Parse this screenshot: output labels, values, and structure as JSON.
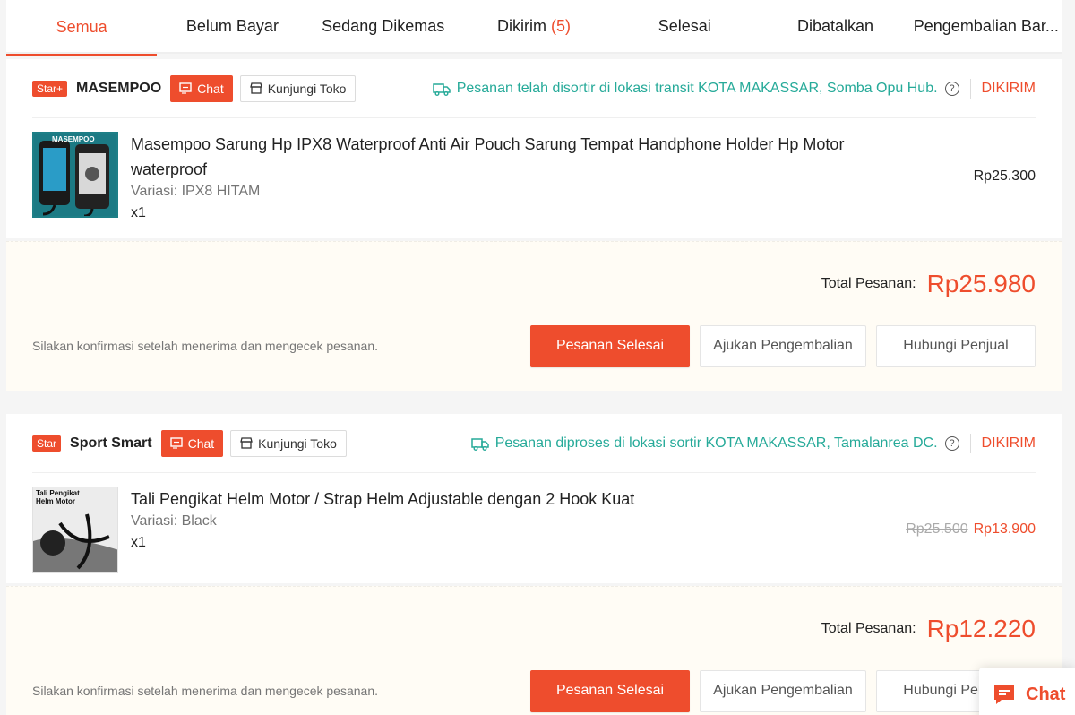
{
  "tabs": [
    {
      "label": "Semua",
      "active": true
    },
    {
      "label": "Belum Bayar"
    },
    {
      "label": "Sedang Dikemas"
    },
    {
      "label": "Dikirim",
      "count": "(5)"
    },
    {
      "label": "Selesai"
    },
    {
      "label": "Dibatalkan"
    },
    {
      "label": "Pengembalian Bar..."
    }
  ],
  "orders": [
    {
      "badge": "Star+",
      "shop_name": "MASEMPOO",
      "chat_label": "Chat",
      "visit_label": "Kunjungi Toko",
      "shipping_text": "Pesanan telah disortir di lokasi transit KOTA MAKASSAR, Somba Opu Hub.",
      "help_icon": "?",
      "status": "DIKIRIM",
      "product": {
        "name": "Masempoo Sarung Hp IPX8 Waterproof Anti Air Pouch Sarung Tempat Handphone Holder Hp Motor waterproof",
        "variation": "Variasi: IPX8 HITAM",
        "qty": "x1",
        "price": "Rp25.300",
        "thumb_label": "MASEMPOO"
      },
      "total_label": "Total Pesanan:",
      "total_value": "Rp25.980",
      "hint": "Silakan konfirmasi setelah menerima dan mengecek pesanan.",
      "btn_complete": "Pesanan Selesai",
      "btn_return": "Ajukan Pengembalian",
      "btn_contact": "Hubungi Penjual"
    },
    {
      "badge": "Star",
      "shop_name": "Sport Smart",
      "chat_label": "Chat",
      "visit_label": "Kunjungi Toko",
      "shipping_text": "Pesanan diproses di lokasi sortir KOTA MAKASSAR, Tamalanrea DC.",
      "help_icon": "?",
      "status": "DIKIRIM",
      "product": {
        "name": "Tali Pengikat Helm Motor / Strap Helm Adjustable dengan 2 Hook Kuat",
        "variation": "Variasi: Black",
        "qty": "x1",
        "price_old": "Rp25.500",
        "price": "Rp13.900",
        "thumb_label_1": "Tali Pengikat",
        "thumb_label_2": "Helm Motor"
      },
      "total_label": "Total Pesanan:",
      "total_value": "Rp12.220",
      "hint": "Silakan konfirmasi setelah menerima dan mengecek pesanan.",
      "btn_complete": "Pesanan Selesai",
      "btn_return": "Ajukan Pengembalian",
      "btn_contact": "Hubungi Penjual"
    }
  ],
  "floating_chat": {
    "label": "Chat"
  },
  "colors": {
    "accent": "#ee4d2d",
    "shipping": "#26aa99"
  }
}
